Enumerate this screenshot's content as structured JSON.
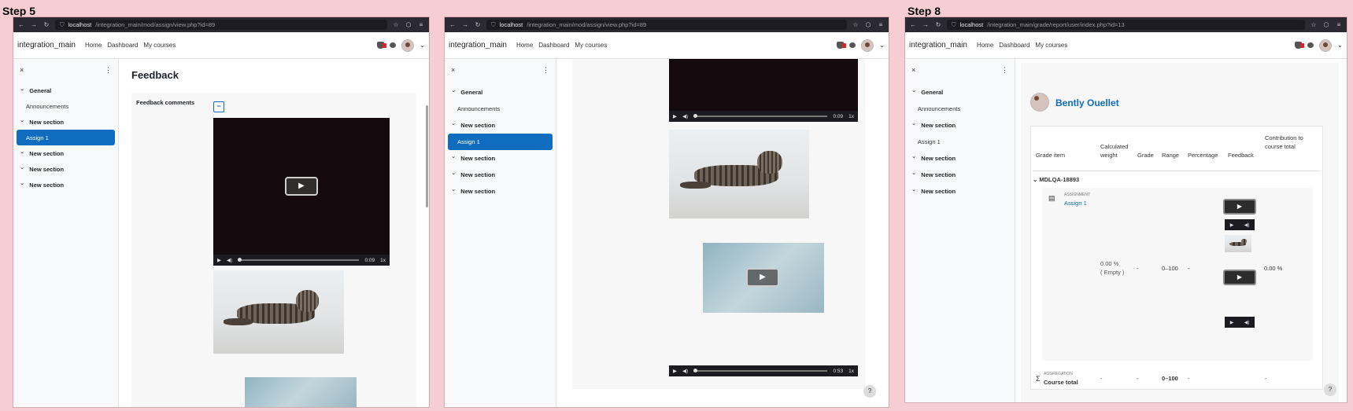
{
  "steps": {
    "left": "Step 5",
    "right": "Step 8"
  },
  "browser": {
    "url1_host": "localhost",
    "url1_path": "/integration_main/mod/assign/view.php?id=89",
    "url2_host": "localhost",
    "url2_path": "/integration_main/mod/assign/view.php?id=89",
    "url3_host": "localhost",
    "url3_path": "/integration_main/grade/report/user/index.php?id=13"
  },
  "nav": {
    "brand": "integration_main",
    "home": "Home",
    "dashboard": "Dashboard",
    "courses": "My courses"
  },
  "drawer": {
    "close": "×",
    "menu": "⋮",
    "items": [
      {
        "label": "General",
        "type": "sec"
      },
      {
        "label": "Announcements",
        "type": "sub"
      },
      {
        "label": "New section",
        "type": "sec"
      },
      {
        "label": "Assign 1",
        "type": "sub"
      },
      {
        "label": "New section",
        "type": "sec"
      },
      {
        "label": "New section",
        "type": "sec"
      },
      {
        "label": "New section",
        "type": "sec"
      }
    ]
  },
  "feedback": {
    "heading": "Feedback",
    "comments_label": "Feedback comments",
    "collapse": "−"
  },
  "video": {
    "play": "▶",
    "mute": "🔊",
    "time1": "0:09",
    "time2": "0:09",
    "time3": "0:53",
    "speed": "1x"
  },
  "grades": {
    "user": "Bently Ouellet",
    "headers": {
      "item": "Grade item",
      "weight": "Calculated weight",
      "grade": "Grade",
      "range": "Range",
      "percentage": "Percentage",
      "feedback": "Feedback",
      "contribution": "Contribution to course total"
    },
    "category": "MDLQA-18893",
    "assign_type": "ASSIGNMENT",
    "assign_name": "Assign 1",
    "weight": "0.00 %",
    "empty": "( Empty )",
    "grade": "-",
    "range": "0–100",
    "percentage": "-",
    "contribution": "0.00 %",
    "agg_type": "AGGREGATION",
    "agg_name": "Course total",
    "agg_weight": "-",
    "agg_grade": "-",
    "agg_range": "0–100",
    "agg_percentage": "-",
    "agg_contribution": "-"
  },
  "help": "?"
}
